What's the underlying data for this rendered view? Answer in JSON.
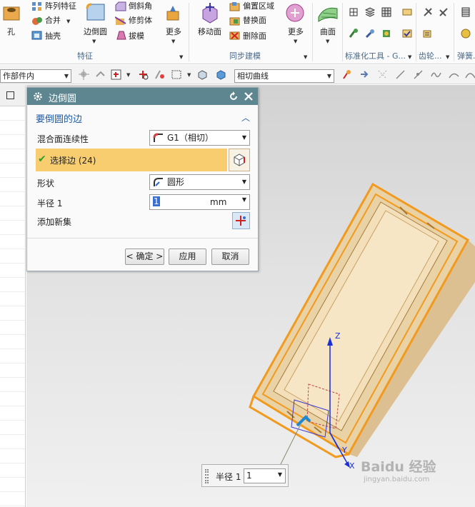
{
  "ribbon": {
    "feature": {
      "hole_label": "孔",
      "pattern_label": "阵列特征",
      "unite_label": "合并",
      "shell_label": "抽壳",
      "edge_blend_label": "边倒圆",
      "chamfer_label": "倒斜角",
      "trim_body_label": "修剪体",
      "draft_label": "拔模",
      "more_label": "更多",
      "group_label": "特征"
    },
    "sync": {
      "move_face_label": "移动面",
      "offset_region_label": "偏置区域",
      "replace_face_label": "替换面",
      "delete_face_label": "删除面",
      "more_label": "更多",
      "group_label": "同步建模"
    },
    "surface": {
      "label": "曲面"
    },
    "std_tools_group_label": "标准化工具 - G...",
    "gear_group_label": "齿轮...",
    "spring_group_label": "弹簧..."
  },
  "toolbar2": {
    "scope_value": "作部件内",
    "curve_rule_value": "相切曲线"
  },
  "dialog": {
    "title": "边倒圆",
    "section_title": "要倒圆的边",
    "continuity_label": "混合面连续性",
    "continuity_value": "G1（相切）",
    "select_edge_label": "选择边 (24)",
    "shape_label": "形状",
    "shape_value": "圆形",
    "radius_label": "半径 1",
    "radius_value": "1",
    "radius_unit": "mm",
    "add_set_label": "添加新集",
    "ok_label": "< 确定 >",
    "apply_label": "应用",
    "cancel_label": "取消"
  },
  "viewport": {
    "axis_z": "Z",
    "axis_y": "Y",
    "axis_x": "X",
    "float_label": "半径 1",
    "float_value": "1",
    "watermark_main": "Baidu 经验",
    "watermark_sub": "jingyan.baidu.com"
  },
  "colors": {
    "ribbon_bg": "#fbfbfb",
    "dialog_title": "#5d8690",
    "selection_bar": "#f8cd70",
    "section_title": "#1f5aa6",
    "model_body": "#f1dcb4",
    "model_edge": "#f29a1e",
    "axis_blue": "#1a2fd6"
  }
}
